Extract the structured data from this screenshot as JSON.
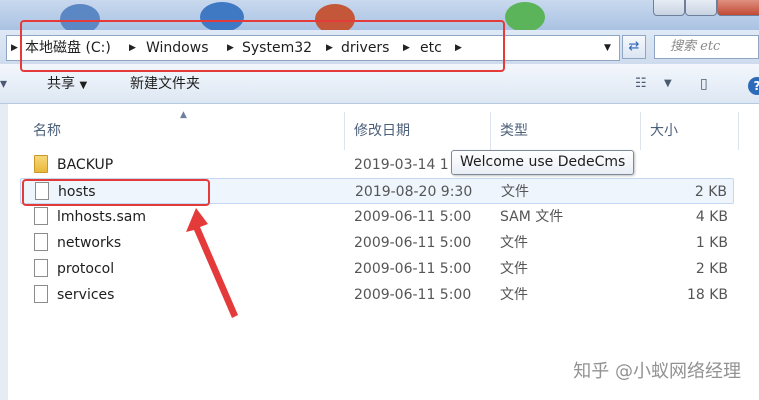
{
  "address": {
    "crumbs": [
      "本地磁盘 (C:)",
      "Windows",
      "System32",
      "drivers",
      "etc"
    ],
    "search_placeholder": "搜索 etc"
  },
  "toolbar": {
    "share_label": "共享",
    "new_folder_label": "新建文件夹"
  },
  "columns": {
    "name": "名称",
    "modified": "修改日期",
    "type": "类型",
    "size": "大小"
  },
  "files": [
    {
      "name": "BACKUP",
      "modified": "2019-03-14 1",
      "type": "",
      "size": "",
      "kind": "folder"
    },
    {
      "name": "hosts",
      "modified": "2019-08-20 9:30",
      "type": "文件",
      "size": "2 KB",
      "kind": "file"
    },
    {
      "name": "lmhosts.sam",
      "modified": "2009-06-11 5:00",
      "type": "SAM 文件",
      "size": "4 KB",
      "kind": "file"
    },
    {
      "name": "networks",
      "modified": "2009-06-11 5:00",
      "type": "文件",
      "size": "1 KB",
      "kind": "file"
    },
    {
      "name": "protocol",
      "modified": "2009-06-11 5:00",
      "type": "文件",
      "size": "2 KB",
      "kind": "file"
    },
    {
      "name": "services",
      "modified": "2009-06-11 5:00",
      "type": "文件",
      "size": "18 KB",
      "kind": "file"
    }
  ],
  "tooltip": "Welcome use DedeCms",
  "watermark": "知乎 @小蚁网络经理",
  "colors": {
    "highlight_red": "#e53a3a",
    "selected_row": "#eef5fd"
  },
  "icons": [
    "folder-icon",
    "file-icon",
    "refresh-icon",
    "view-options-icon",
    "preview-pane-icon",
    "help-icon"
  ]
}
